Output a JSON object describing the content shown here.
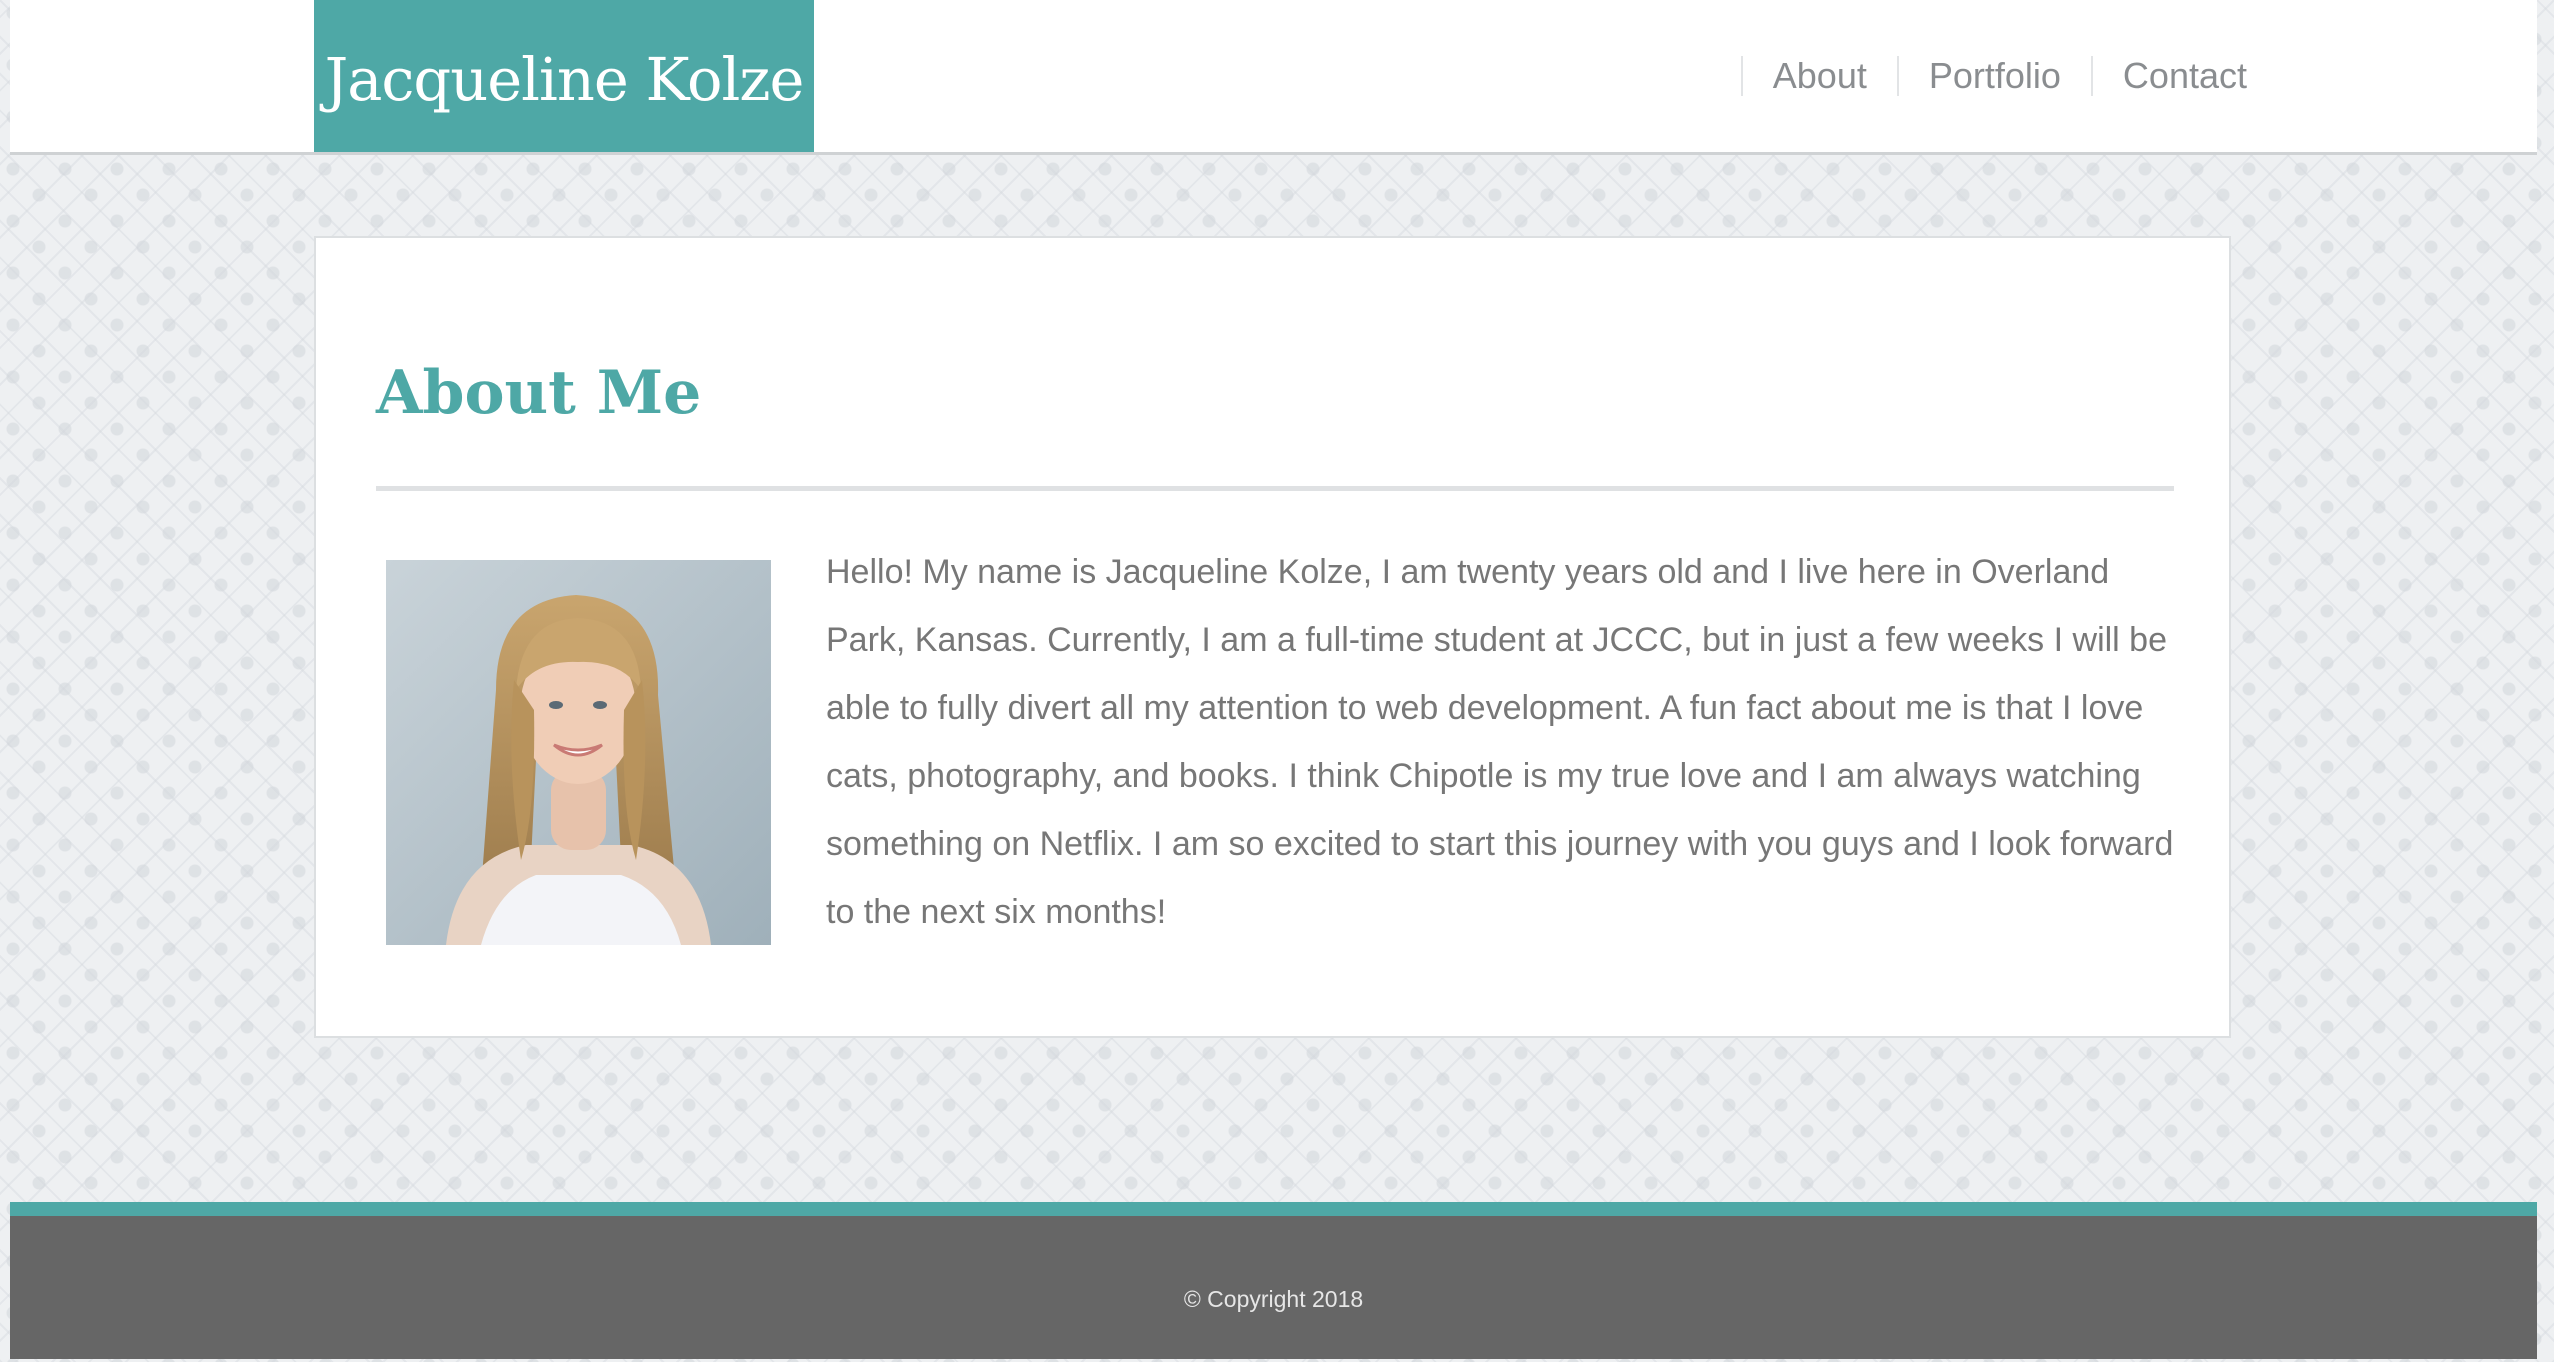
{
  "header": {
    "site_name": "Jacqueline Kolze",
    "nav": [
      {
        "label": "About"
      },
      {
        "label": "Portfolio"
      },
      {
        "label": "Contact"
      }
    ]
  },
  "main": {
    "title": "About Me",
    "bio": "Hello! My name is Jacqueline Kolze, I am twenty years old and I live here in Overland Park, Kansas. Currently, I am a full-time student at JCCC, but in just a few weeks I will be able to fully divert all my attention to web development. A fun fact about me is that I love cats, photography, and books. I think Chipotle is my true love and I am always watching something on Netflix. I am so excited to start this journey with you guys and I look forward to the next six months!"
  },
  "footer": {
    "copyright": "© Copyright 2018"
  },
  "colors": {
    "accent": "#4ea8a6",
    "footer_bg": "#666666",
    "text": "#777777",
    "nav_text": "#8a8d90"
  }
}
